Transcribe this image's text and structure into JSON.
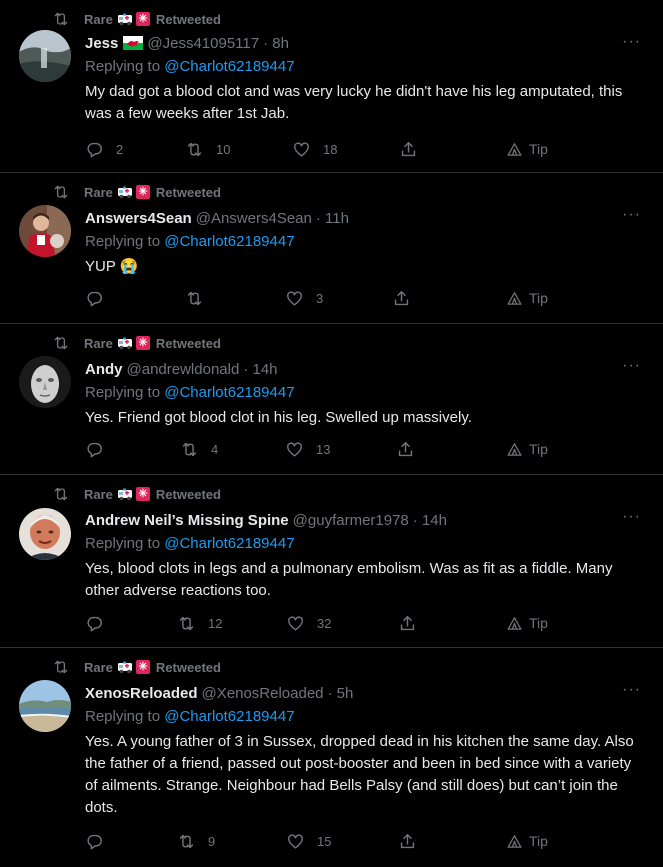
{
  "tweets": [
    {
      "retweeted_by": "Rare",
      "retweeted_label": "Retweeted",
      "name": "Jess",
      "has_flag": true,
      "handle": "@Jess41095117",
      "time": "· 8h",
      "replying_prefix": "Replying to",
      "replying_to": "@Charlot62189447",
      "text": "My dad got a blood clot and was very lucky he didn't have his leg amputated, this was a few weeks after 1st Jab.",
      "replies": "2",
      "retweets": "10",
      "likes": "18",
      "tip_label": "Tip"
    },
    {
      "retweeted_by": "Rare",
      "retweeted_label": "Retweeted",
      "name": "Answers4Sean",
      "has_flag": false,
      "handle": "@Answers4Sean",
      "time": "· 11h",
      "replying_prefix": "Replying to",
      "replying_to": "@Charlot62189447",
      "text": "YUP 😭",
      "replies": "",
      "retweets": "",
      "likes": "3",
      "tip_label": "Tip"
    },
    {
      "retweeted_by": "Rare",
      "retweeted_label": "Retweeted",
      "name": "Andy",
      "has_flag": false,
      "handle": "@andrewldonald",
      "time": "· 14h",
      "replying_prefix": "Replying to",
      "replying_to": "@Charlot62189447",
      "text": "Yes. Friend got blood clot in his leg. Swelled up massively.",
      "replies": "",
      "retweets": "4",
      "likes": "13",
      "tip_label": "Tip"
    },
    {
      "retweeted_by": "Rare",
      "retweeted_label": "Retweeted",
      "name": "Andrew Neil’s Missing Spine",
      "has_flag": false,
      "handle": "@guyfarmer1978",
      "time": "· 14h",
      "replying_prefix": "Replying to",
      "replying_to": "@Charlot62189447",
      "text": "Yes, blood clots in legs and a pulmonary embolism. Was as fit as a fiddle. Many other adverse reactions too.",
      "replies": "",
      "retweets": "12",
      "likes": "32",
      "tip_label": "Tip"
    },
    {
      "retweeted_by": "Rare",
      "retweeted_label": "Retweeted",
      "name": "XenosReloaded",
      "has_flag": false,
      "handle": "@XenosReloaded",
      "time": "· 5h",
      "replying_prefix": "Replying to",
      "replying_to": "@Charlot62189447",
      "text": "Yes. A young father of 3 in Sussex, dropped dead in his kitchen the same day. Also the father of a friend, passed out post-booster and been in bed since with a variety of ailments. Strange. Neighbour had Bells Palsy (and still does) but can’t join the dots.",
      "replies": "",
      "retweets": "9",
      "likes": "15",
      "tip_label": "Tip"
    }
  ],
  "colors": {
    "background": "#000000",
    "text": "#e7e9ea",
    "muted": "#71767b",
    "link": "#1d9bf0",
    "divider": "#2f3336"
  },
  "icons": [
    "retweet-icon",
    "ambulance-emoji",
    "siren-emoji",
    "wales-flag-emoji",
    "more-icon",
    "reply-icon",
    "like-icon",
    "share-icon",
    "tip-icon"
  ]
}
